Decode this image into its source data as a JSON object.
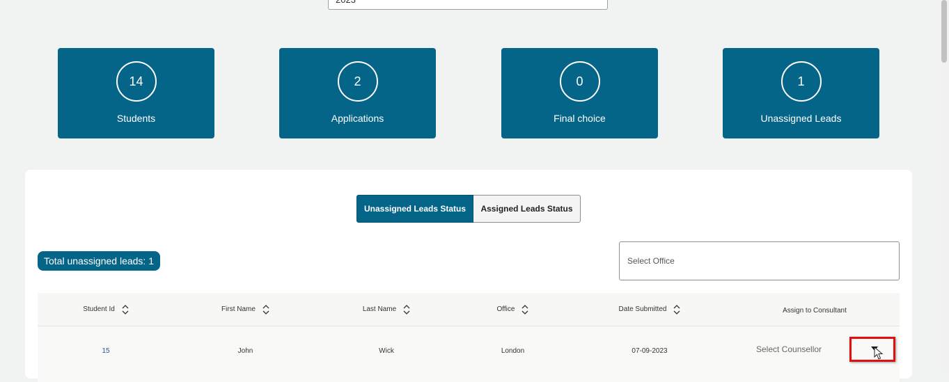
{
  "filter": {
    "year_value": "2023"
  },
  "stats": [
    {
      "value": "14",
      "label": "Students"
    },
    {
      "value": "2",
      "label": "Applications"
    },
    {
      "value": "0",
      "label": "Final choice"
    },
    {
      "value": "1",
      "label": "Unassigned Leads"
    }
  ],
  "tabs": {
    "unassigned": "Unassigned Leads Status",
    "assigned": "Assigned Leads Status"
  },
  "total_badge": "Total unassigned leads: 1",
  "office_select": {
    "placeholder": "Select Office"
  },
  "table": {
    "columns": [
      "Student Id",
      "First Name",
      "Last Name",
      "Office",
      "Date Submitted",
      "Assign to Consultant"
    ],
    "rows": [
      {
        "student_id": "15",
        "first_name": "John",
        "last_name": "Wick",
        "office": "London",
        "date_submitted": "07-09-2023",
        "counsellor": "Select Counsellor"
      }
    ]
  },
  "colors": {
    "primary": "#056589",
    "highlight": "#e01010",
    "background": "#f1f2f2"
  }
}
